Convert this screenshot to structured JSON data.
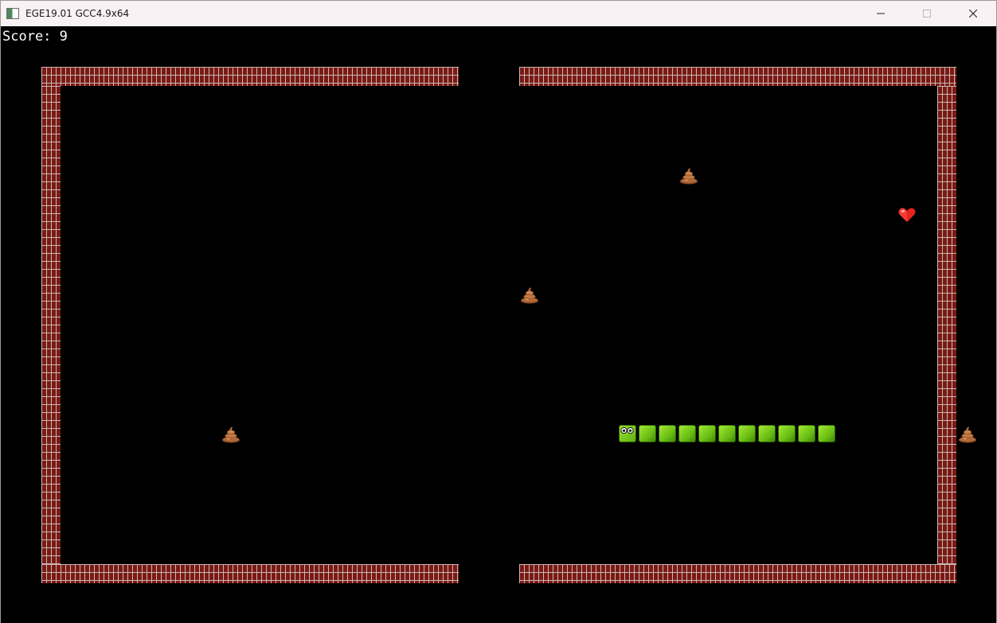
{
  "window": {
    "title": "EGE19.01 GCC4.9x64",
    "controls": [
      "minimize-icon",
      "maximize-icon",
      "close-icon"
    ]
  },
  "hud": {
    "score_label": "Score:",
    "score_value": "9"
  },
  "game": {
    "colors": {
      "background": "#000000",
      "brick": "#7a1a14",
      "mortar": "#c9b7b4",
      "snake": "#6dc414"
    },
    "snake": {
      "length": 11,
      "direction": "left"
    },
    "items": [
      {
        "kind": "poop",
        "icon": "poop-icon"
      },
      {
        "kind": "poop",
        "icon": "poop-icon"
      },
      {
        "kind": "poop",
        "icon": "poop-icon"
      },
      {
        "kind": "poop",
        "icon": "poop-icon"
      },
      {
        "kind": "heart",
        "icon": "heart-icon"
      }
    ]
  }
}
